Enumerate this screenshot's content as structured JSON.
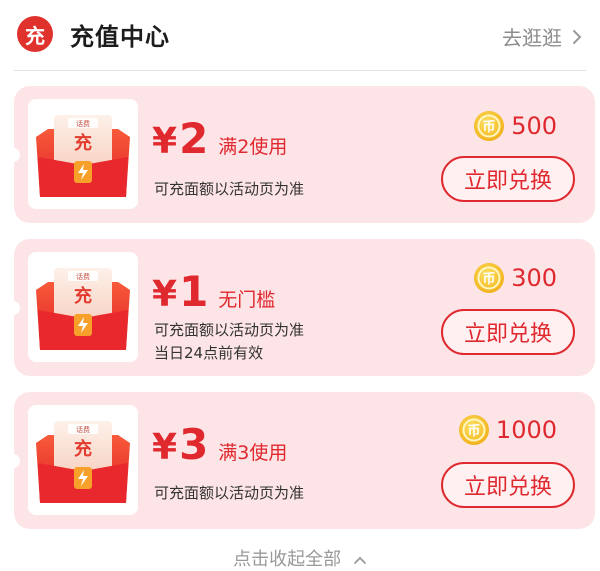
{
  "header": {
    "badge": "充",
    "title": "充值中心",
    "more_label": "去逛逛"
  },
  "thumb_label": "话费",
  "thumb_char": "充",
  "cards": [
    {
      "yen": "¥",
      "amount": "2",
      "condition": "满2使用",
      "desc1": "可充面额以活动页为准",
      "desc2": "",
      "coins": "500",
      "button": "立即兑换"
    },
    {
      "yen": "¥",
      "amount": "1",
      "condition": "无门槛",
      "desc1": "可充面额以活动页为准",
      "desc2": "当日24点前有效",
      "coins": "300",
      "button": "立即兑换"
    },
    {
      "yen": "¥",
      "amount": "3",
      "condition": "满3使用",
      "desc1": "可充面额以活动页为准",
      "desc2": "",
      "coins": "1000",
      "button": "立即兑换"
    }
  ],
  "footer": {
    "collapse_label": "点击收起全部"
  },
  "colors": {
    "brand_red": "#e0282f",
    "card_bg": "#fde4e6",
    "coin_gold": "#f2bf22"
  }
}
